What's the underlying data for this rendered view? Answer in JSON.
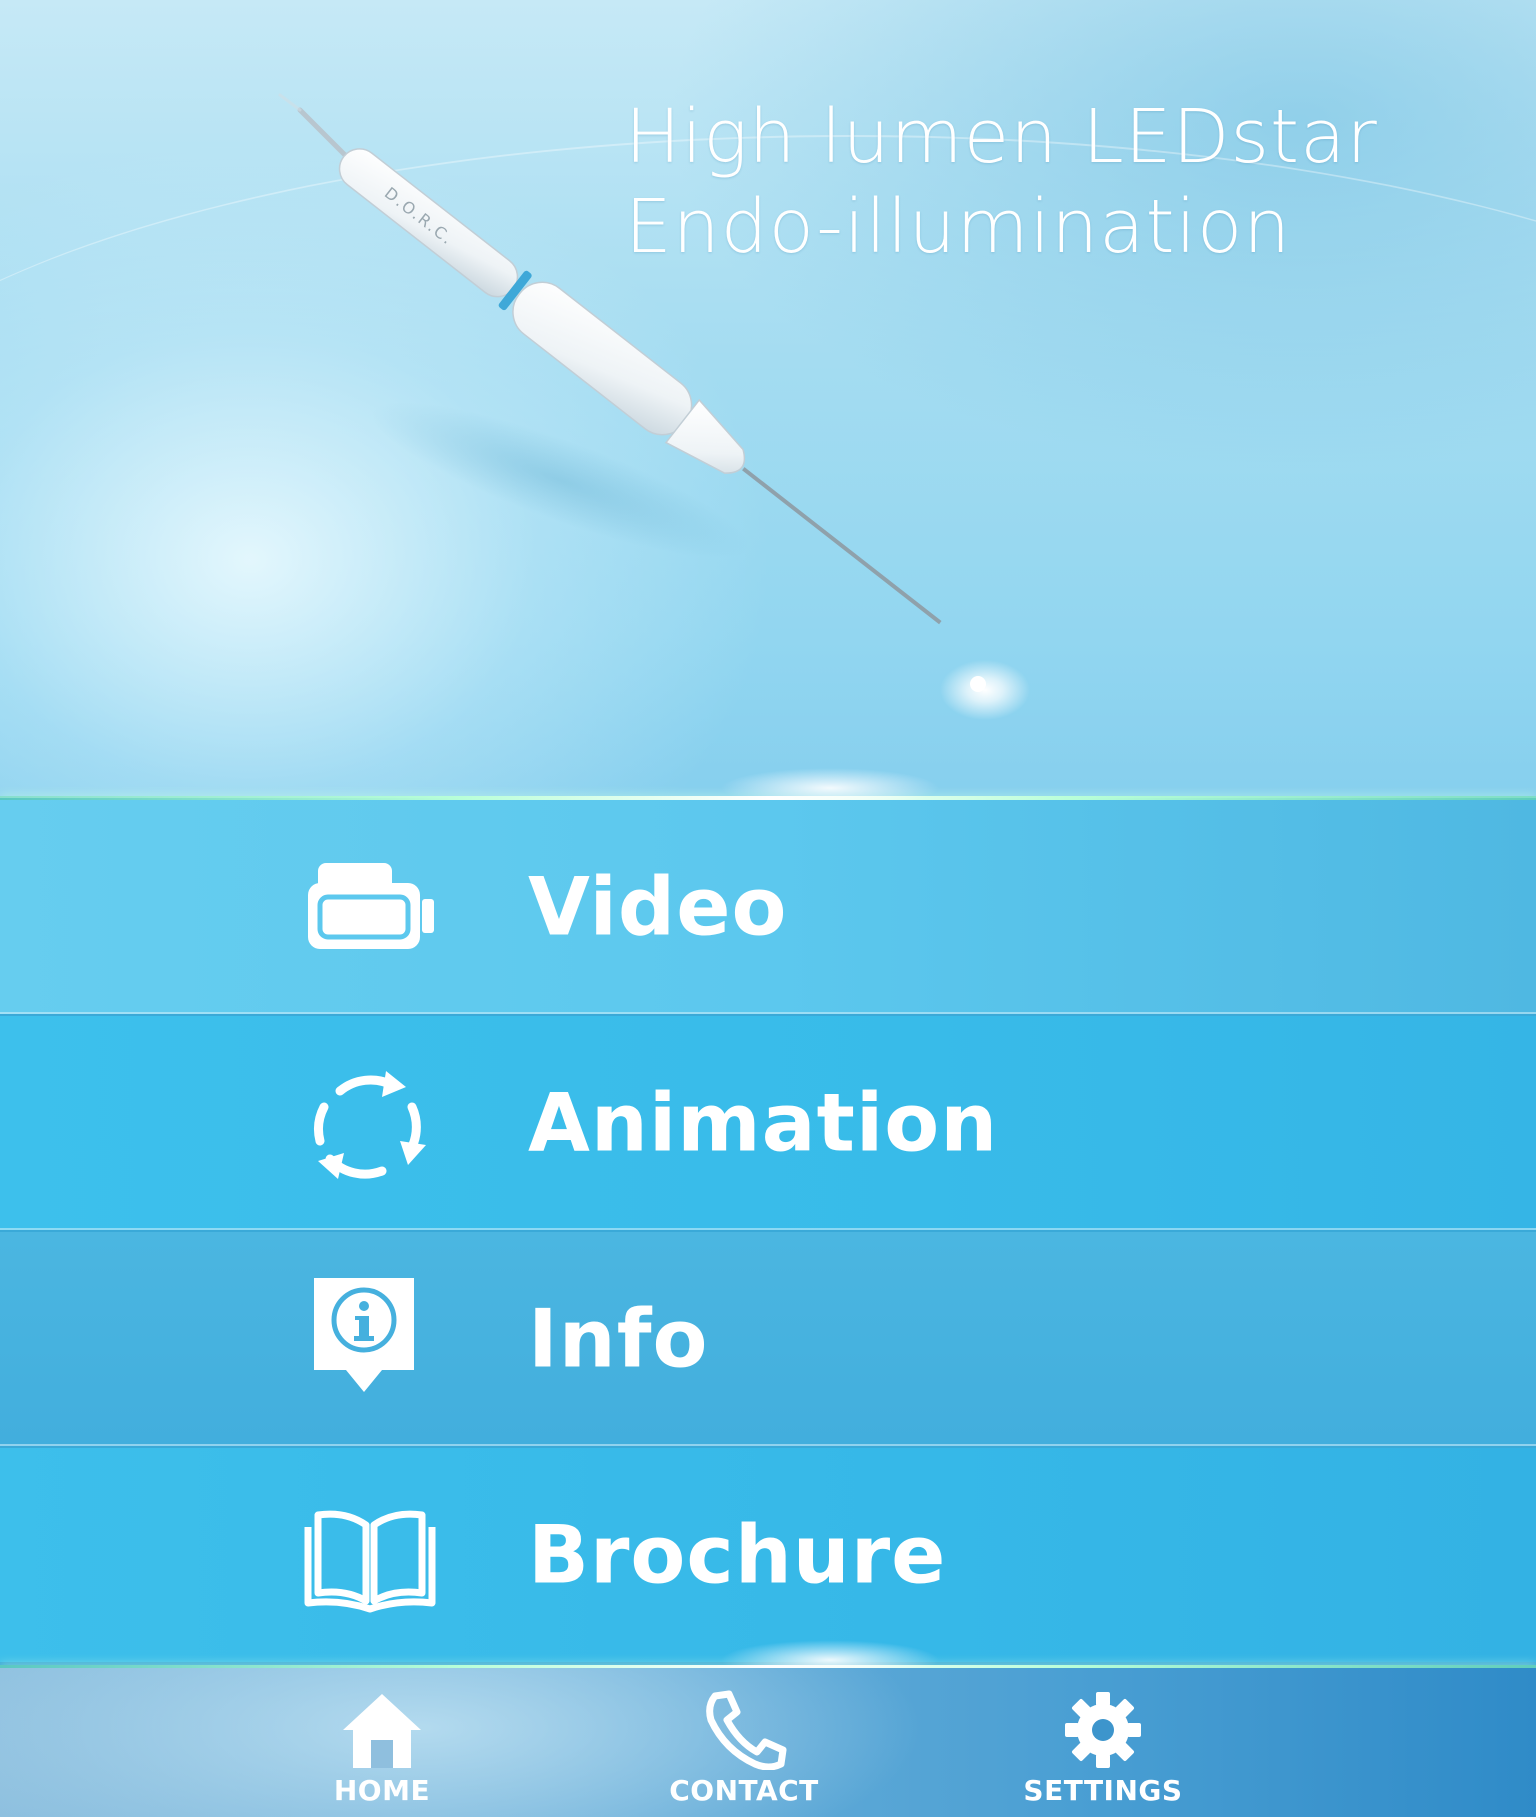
{
  "hero": {
    "title_line1": "High lumen LEDstar",
    "title_line2": "Endo-illumination",
    "product_brand": "D.O.R.C."
  },
  "menu": {
    "items": [
      {
        "label": "Video",
        "icon": "video-camera-icon"
      },
      {
        "label": "Animation",
        "icon": "refresh-cycle-icon"
      },
      {
        "label": "Info",
        "icon": "info-bubble-icon"
      },
      {
        "label": "Brochure",
        "icon": "open-book-icon"
      }
    ]
  },
  "bottom_nav": {
    "items": [
      {
        "label": "HOME",
        "icon": "home-icon"
      },
      {
        "label": "CONTACT",
        "icon": "phone-icon"
      },
      {
        "label": "SETTINGS",
        "icon": "gear-icon"
      }
    ]
  },
  "colors": {
    "menu_video": "#5cc8ee",
    "menu_animation": "#38bbe9",
    "menu_info": "#45b0de",
    "menu_brochure": "#36b8e8",
    "accent_glow": "#b8ffd8",
    "text": "#ffffff"
  }
}
